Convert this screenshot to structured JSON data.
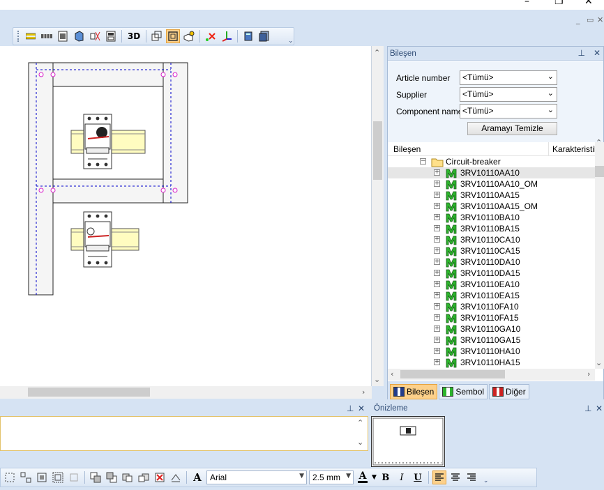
{
  "colors": {
    "accent_active": "#fcd08a",
    "panel_bg": "#d6e3f3",
    "component_icon_green": "#2db52d",
    "rail_yellow": "#fffcc0",
    "snap_point_magenta": "#d81fc9"
  },
  "top_toolbar": {
    "button_3d": "3D",
    "icons": [
      "layers-icon",
      "grid-icon",
      "page-icon",
      "box-icon",
      "cut-icon",
      "form-icon",
      "3d-view",
      "copy-frame-icon",
      "frame-select-icon",
      "place-icon",
      "delete-x-icon",
      "axis-icon",
      "stack-icon",
      "stack-2-icon"
    ]
  },
  "component_panel": {
    "title": "Bileşen",
    "filters": [
      {
        "label": "Article number",
        "value": "<Tümü>"
      },
      {
        "label": "Supplier",
        "value": "<Tümü>"
      },
      {
        "label": "Component name",
        "value": "<Tümü>"
      }
    ],
    "clear_button": "Aramayı Temizle",
    "columns": [
      "Bileşen",
      "Karakteristik"
    ],
    "folder": "Circuit-breaker",
    "items": [
      "3RV10110AA10",
      "3RV10110AA10_OM",
      "3RV10110AA15",
      "3RV10110AA15_OM",
      "3RV10110BA10",
      "3RV10110BA15",
      "3RV10110CA10",
      "3RV10110CA15",
      "3RV10110DA10",
      "3RV10110DA15",
      "3RV10110EA10",
      "3RV10110EA15",
      "3RV10110FA10",
      "3RV10110FA15",
      "3RV10110GA10",
      "3RV10110GA15",
      "3RV10110HA10",
      "3RV10110HA15"
    ],
    "selected_item": "3RV10110AA10",
    "tabs": [
      "Bileşen",
      "Sembol",
      "Diğer"
    ]
  },
  "preview_panel": {
    "title": "Önizleme"
  },
  "bottom_toolbar": {
    "font": "Arial",
    "font_size": "2.5 mm",
    "bold": "B",
    "italic": "I",
    "underline": "U",
    "text_color_glyph": "A",
    "font_glyph": "A"
  }
}
